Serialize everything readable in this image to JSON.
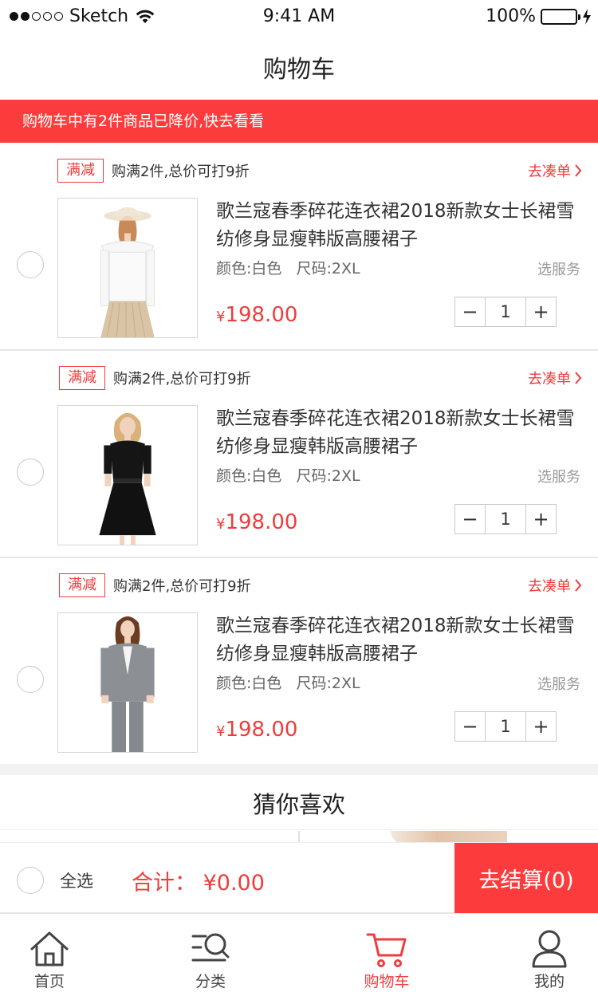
{
  "status_bar": {
    "carrier": "Sketch",
    "time": "9:41 AM",
    "battery": "100%"
  },
  "header": {
    "title": "购物车"
  },
  "notice": {
    "text": "购物车中有2件商品已降价,快去看看"
  },
  "items": [
    {
      "promo_tag": "满减",
      "promo_text": "购满2件,总价可打9折",
      "promo_link": "去凑单",
      "title": "歌兰寇春季碎花连衣裙2018新款女士长裙雪纺修身显瘦韩版高腰裙子",
      "color": "颜色:白色",
      "size": "尺码:2XL",
      "service": "选服务",
      "currency": "¥",
      "price": "198.00",
      "qty": "1",
      "image": "white-blouse-pleated-skirt"
    },
    {
      "promo_tag": "满减",
      "promo_text": "购满2件,总价可打9折",
      "promo_link": "去凑单",
      "title": "歌兰寇春季碎花连衣裙2018新款女士长裙雪纺修身显瘦韩版高腰裙子",
      "color": "颜色:白色",
      "size": "尺码:2XL",
      "service": "选服务",
      "currency": "¥",
      "price": "198.00",
      "qty": "1",
      "image": "black-dress"
    },
    {
      "promo_tag": "满减",
      "promo_text": "购满2件,总价可打9折",
      "promo_link": "去凑单",
      "title": "歌兰寇春季碎花连衣裙2018新款女士长裙雪纺修身显瘦韩版高腰裙子",
      "color": "颜色:白色",
      "size": "尺码:2XL",
      "service": "选服务",
      "currency": "¥",
      "price": "198.00",
      "qty": "1",
      "image": "grey-suit"
    }
  ],
  "guess": {
    "title": "猜你喜欢"
  },
  "checkout": {
    "select_all": "全选",
    "total": "合计： ¥0.00",
    "pay_button": "去结算(0)"
  },
  "tabbar": [
    {
      "label": "首页",
      "icon": "home-icon"
    },
    {
      "label": "分类",
      "icon": "category-search-icon"
    },
    {
      "label": "购物车",
      "icon": "cart-icon",
      "active": true
    },
    {
      "label": "我的",
      "icon": "user-icon"
    }
  ],
  "colors": {
    "accent": "#fc3c3c",
    "price": "#f03c3c",
    "battery": "#4cd964"
  }
}
